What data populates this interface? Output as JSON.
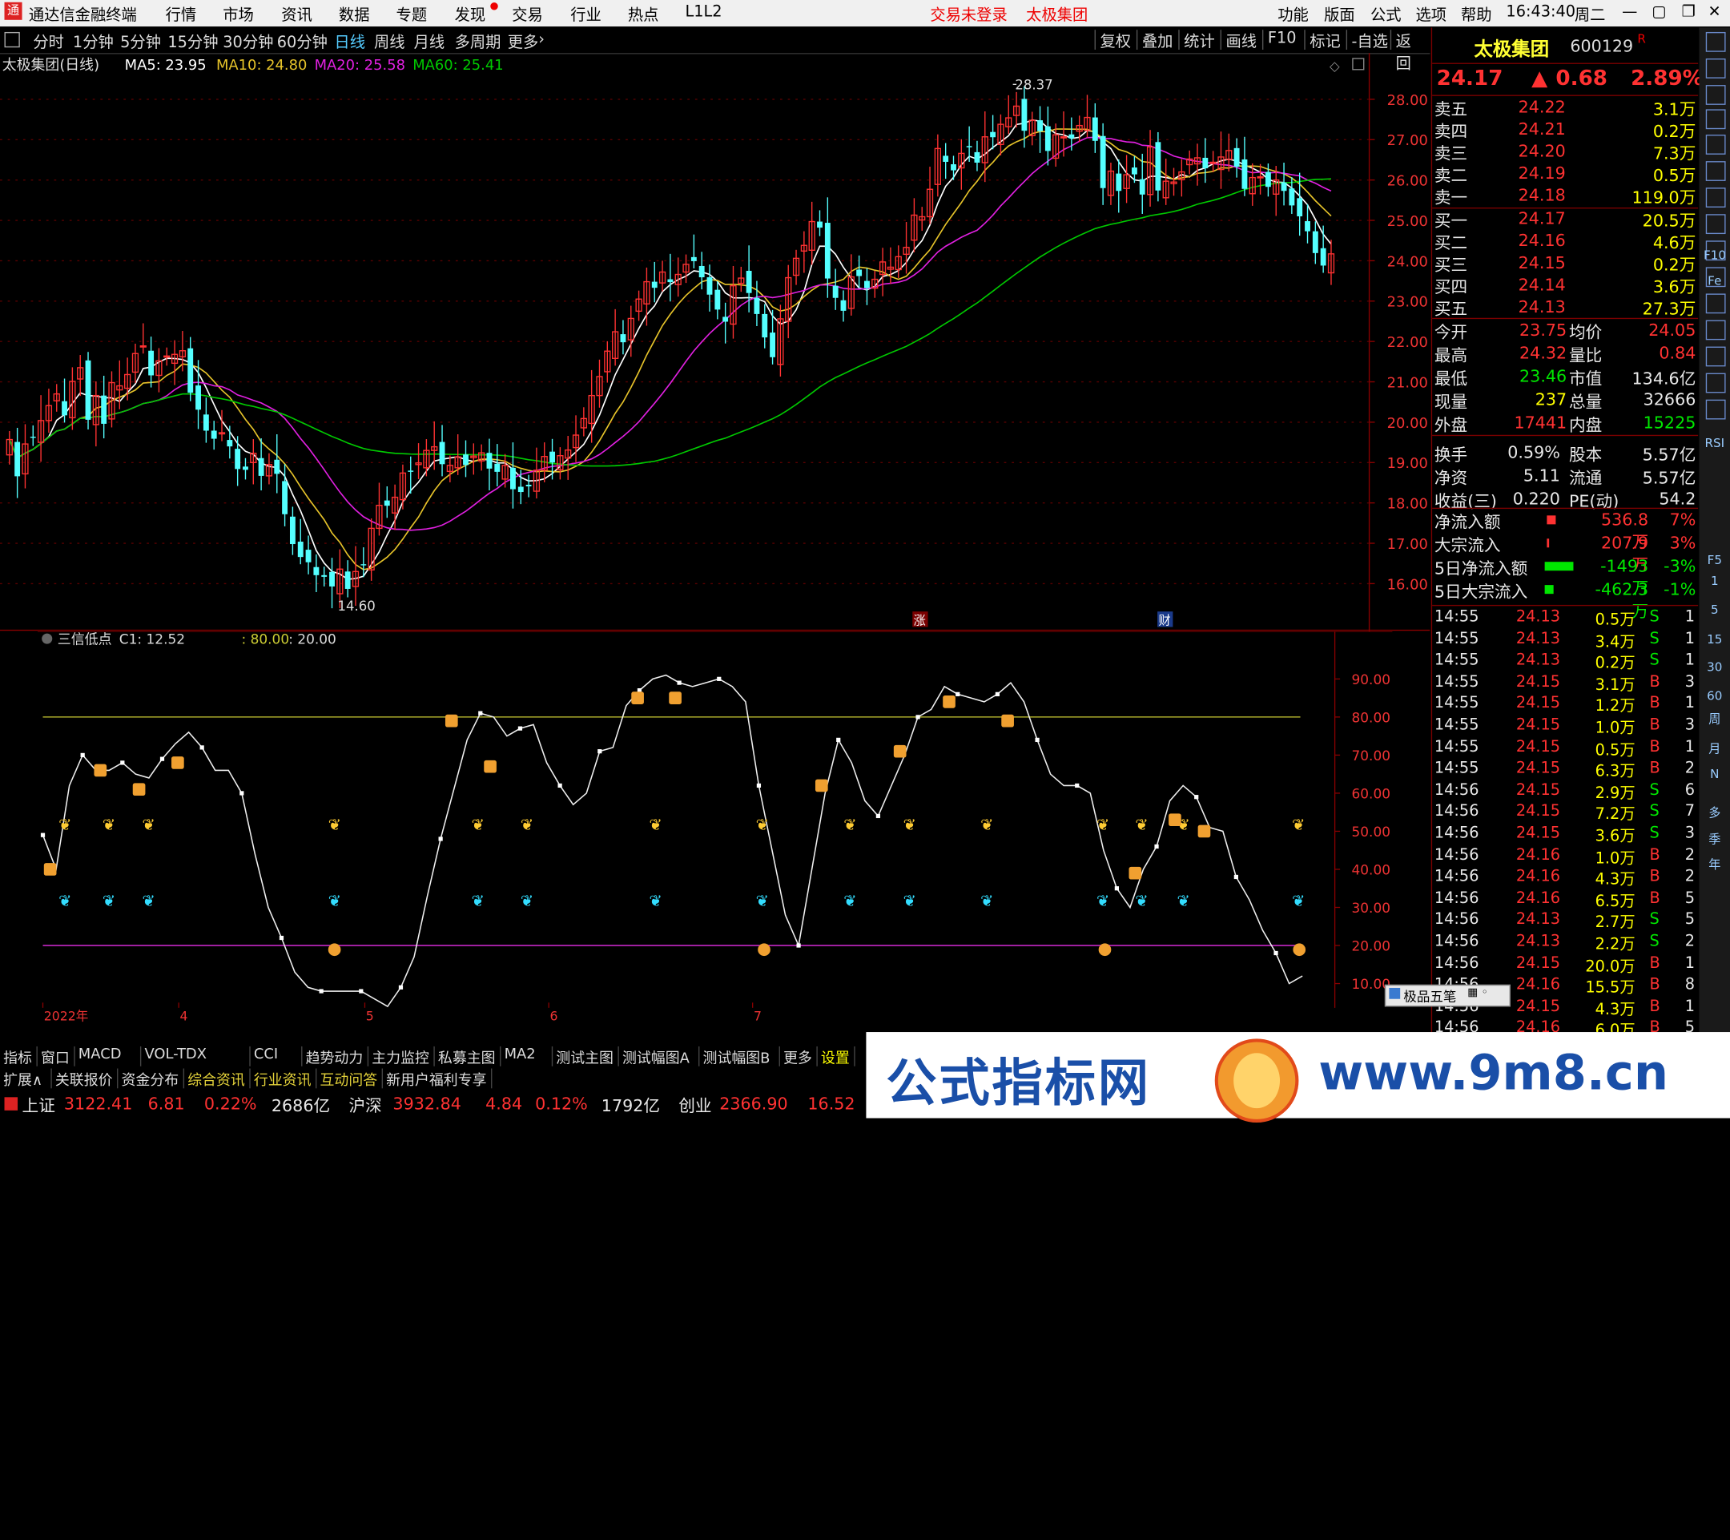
{
  "window": {
    "app_title": "通达信金融终端",
    "menu": [
      "行情",
      "市场",
      "资讯",
      "数据",
      "专题",
      "发现",
      "交易",
      "行业",
      "热点",
      "L1L2"
    ],
    "center": [
      "交易未登录",
      "太极集团"
    ],
    "right_menu": [
      "功能",
      "版面",
      "公式",
      "选项",
      "帮助"
    ],
    "clock": "16:43:40",
    "weekday": "周二"
  },
  "periods": [
    "分时",
    "1分钟",
    "5分钟",
    "15分钟",
    "30分钟",
    "60分钟",
    "日线",
    "周线",
    "月线",
    "多周期",
    "更多"
  ],
  "active_period": "日线",
  "toolbar": [
    "复权",
    "叠加",
    "统计",
    "画线",
    "F10",
    "标记",
    "-自选",
    "返回"
  ],
  "main_header": {
    "name": "太极集团(日线)",
    "ma5": "MA5: 23.95",
    "ma10": "MA10: 24.80",
    "ma20": "MA20: 25.58",
    "ma60": "MA60: 25.41"
  },
  "sub_header": {
    "name": "三信低点",
    "c1": "C1: 12.52",
    "l80": ": 80.00",
    "l20": ": 20.00"
  },
  "markers": {
    "high": "28.37",
    "low": "14.60",
    "zhang": "涨",
    "cai": "财"
  },
  "xaxis": [
    "2022年",
    "4",
    "5",
    "6",
    "7"
  ],
  "stock": {
    "name": "太极集团",
    "code": "600129",
    "r": "R",
    "price": "24.17",
    "change": "0.68",
    "pct": "2.89%"
  },
  "sell": [
    {
      "label": "卖五",
      "price": "24.22",
      "vol": "3.1万"
    },
    {
      "label": "卖四",
      "price": "24.21",
      "vol": "0.2万"
    },
    {
      "label": "卖三",
      "price": "24.20",
      "vol": "7.3万"
    },
    {
      "label": "卖二",
      "price": "24.19",
      "vol": "0.5万"
    },
    {
      "label": "卖一",
      "price": "24.18",
      "vol": "119.0万"
    }
  ],
  "buy": [
    {
      "label": "买一",
      "price": "24.17",
      "vol": "20.5万"
    },
    {
      "label": "买二",
      "price": "24.16",
      "vol": "4.6万"
    },
    {
      "label": "买三",
      "price": "24.15",
      "vol": "0.2万"
    },
    {
      "label": "买四",
      "price": "24.14",
      "vol": "3.6万"
    },
    {
      "label": "买五",
      "price": "24.13",
      "vol": "27.3万"
    }
  ],
  "stats": [
    [
      "今开",
      "23.75",
      "均价",
      "24.05"
    ],
    [
      "最高",
      "24.32",
      "量比",
      "0.84"
    ],
    [
      "最低",
      "23.46",
      "市值",
      "134.6亿"
    ],
    [
      "现量",
      "237",
      "总量",
      "32666"
    ],
    [
      "外盘",
      "17441",
      "内盘",
      "15225"
    ],
    [
      "换手",
      "0.59%",
      "股本",
      "5.57亿"
    ],
    [
      "净资",
      "5.11",
      "流通",
      "5.57亿"
    ],
    [
      "收益(三)",
      "0.220",
      "PE(动)",
      "54.2"
    ]
  ],
  "flows": [
    [
      "净流入额",
      "536.8万",
      "7%"
    ],
    [
      "大宗流入",
      "207.9万",
      "3%"
    ],
    [
      "5日净流入额",
      "-1493万",
      "-3%"
    ],
    [
      "5日大宗流入",
      "-462.3万",
      "-1%"
    ]
  ],
  "ticks": [
    [
      "14:55",
      "24.13",
      "0.5万",
      "S",
      "1"
    ],
    [
      "14:55",
      "24.13",
      "3.4万",
      "S",
      "1"
    ],
    [
      "14:55",
      "24.13",
      "0.2万",
      "S",
      "1"
    ],
    [
      "14:55",
      "24.15",
      "3.1万",
      "B",
      "3"
    ],
    [
      "14:55",
      "24.15",
      "1.2万",
      "B",
      "1"
    ],
    [
      "14:55",
      "24.15",
      "1.0万",
      "B",
      "3"
    ],
    [
      "14:55",
      "24.15",
      "0.5万",
      "B",
      "1"
    ],
    [
      "14:55",
      "24.15",
      "6.3万",
      "B",
      "2"
    ],
    [
      "14:56",
      "24.15",
      "2.9万",
      "S",
      "6"
    ],
    [
      "14:56",
      "24.15",
      "7.2万",
      "S",
      "7"
    ],
    [
      "14:56",
      "24.15",
      "3.6万",
      "S",
      "3"
    ],
    [
      "14:56",
      "24.16",
      "1.0万",
      "B",
      "2"
    ],
    [
      "14:56",
      "24.16",
      "4.3万",
      "B",
      "2"
    ],
    [
      "14:56",
      "24.16",
      "6.5万",
      "B",
      "5"
    ],
    [
      "14:56",
      "24.13",
      "2.7万",
      "S",
      "5"
    ],
    [
      "14:56",
      "24.13",
      "2.2万",
      "S",
      "2"
    ],
    [
      "14:56",
      "24.15",
      "20.0万",
      "B",
      "1"
    ],
    [
      "14:56",
      "24.16",
      "15.5万",
      "B",
      "8"
    ],
    [
      "14:56",
      "24.15",
      "4.3万",
      "B",
      "1"
    ],
    [
      "14:56",
      "24.16",
      "6.0万",
      "B",
      "5"
    ]
  ],
  "popup": "极品五笔",
  "tabs1": [
    "指标",
    "窗口",
    "MACD",
    "VOL-TDX",
    "CCI",
    "趋势动力",
    "主力监控",
    "私募主图",
    "MA2",
    "测试主图",
    "测试幅图A",
    "测试幅图B",
    "更多",
    "设置"
  ],
  "tabs2": [
    "扩展∧",
    "关联报价",
    "资金分布",
    "综合资讯",
    "行业资讯",
    "互动问答",
    "新用户福利专享"
  ],
  "status": {
    "sh": "上证",
    "sh_v": "3122.41",
    "sh_c": "6.81",
    "sh_p": "0.22%",
    "sh_a": "2686亿",
    "sz": "沪深",
    "sz_v": "3932.84",
    "sz_c": "4.84",
    "sz_p": "0.12%",
    "sz_a": "1792亿",
    "cy": "创业",
    "cy_v": "2366.90",
    "cy_c": "16.52"
  },
  "watermark": {
    "text": "公式指标网",
    "url": "www.9m8.cn"
  },
  "right_icons": [
    "RSI",
    "多",
    "季",
    "年",
    "周",
    "月",
    "N",
    "1",
    "5",
    "15",
    "30",
    "60",
    "F10",
    "Fe",
    "F5"
  ],
  "chart_data": [
    {
      "type": "candlestick",
      "title": "太极集团(日线)",
      "ylim": [
        15.2,
        28.6
      ],
      "yticks": [
        16,
        17,
        18,
        19,
        20,
        21,
        22,
        23,
        24,
        25,
        26,
        27,
        28
      ],
      "series": [
        {
          "name": "MA5",
          "color": "#ffffff"
        },
        {
          "name": "MA10",
          "color": "#e6c32a"
        },
        {
          "name": "MA20",
          "color": "#e020e0"
        },
        {
          "name": "MA60",
          "color": "#00c800"
        }
      ],
      "close": [
        19.57,
        18.66,
        19.46,
        19.62,
        20.04,
        20.41,
        20.7,
        20.17,
        21.01,
        21.35,
        20.06,
        20.66,
        19.96,
        20.98,
        20.9,
        21.18,
        21.7,
        21.89,
        21.16,
        21.52,
        21.64,
        21.68,
        21.77,
        20.73,
        20.31,
        19.79,
        19.59,
        19.74,
        19.4,
        18.84,
        18.82,
        19.23,
        18.67,
        18.95,
        18.72,
        17.72,
        16.98,
        16.66,
        16.53,
        16.21,
        16.17,
        15.93,
        16.36,
        15.87,
        16.3,
        16.46,
        17.37,
        17.94,
        17.93,
        18.14,
        18.74,
        18.77,
        18.99,
        19.3,
        19.39,
        18.96,
        18.93,
        19.14,
        18.94,
        19.16,
        19.24,
        18.85,
        18.77,
        18.93,
        18.34,
        18.27,
        18.41,
        18.81,
        19.15,
        19.0,
        19.17,
        19.31,
        19.68,
        20.09,
        20.66,
        21.13,
        21.76,
        22.24,
        21.98,
        22.57,
        23.05,
        23.48,
        23.33,
        23.72,
        23.47,
        23.66,
        23.91,
        23.99,
        23.59,
        23.16,
        22.79,
        22.49,
        23.38,
        23.57,
        23.2,
        22.68,
        22.1,
        21.61,
        22.56,
        23.58,
        24.06,
        24.38,
        24.97,
        24.82,
        23.56,
        23.08,
        22.76,
        23.6,
        23.62,
        23.32,
        23.54,
        23.97,
        23.84,
        24.1,
        24.33,
        25.13,
        25.09,
        25.77,
        26.78,
        26.45,
        26.24,
        26.66,
        26.81,
        26.43,
        27.07,
        27.06,
        27.38,
        27.54,
        27.83,
        27.22,
        27.48,
        27.21,
        26.72,
        27.12,
        27.07,
        27.03,
        27.35,
        27.55,
        26.97,
        25.8,
        26.22,
        25.73,
        26.13,
        26.14,
        25.64,
        26.82,
        25.74,
        25.97,
        25.95,
        26.2,
        26.52,
        26.55,
        26.29,
        26.44,
        26.57,
        26.73,
        26.33,
        25.78,
        26.06,
        26.08,
        25.83,
        26.0,
        25.73,
        25.37,
        25.1,
        24.73,
        24.19,
        23.88,
        24.17
      ],
      "high": 28.37,
      "low": 14.6
    },
    {
      "type": "line",
      "title": "三信低点",
      "ylim": [
        5,
        97
      ],
      "yticks": [
        10,
        20,
        30,
        40,
        50,
        60,
        70,
        80,
        90
      ],
      "hlines": [
        {
          "value": 80,
          "color": "#cccc33"
        },
        {
          "value": 20,
          "color": "#ff33ff"
        }
      ],
      "c1": [
        49,
        40,
        62,
        70,
        66,
        66,
        68,
        65,
        64,
        69,
        73,
        76,
        72,
        66,
        66,
        60,
        44,
        30,
        22,
        13,
        9,
        8,
        8,
        8,
        8,
        6,
        4,
        9,
        17,
        33,
        48,
        61,
        74,
        81,
        80,
        75,
        77,
        78,
        68,
        62,
        57,
        60,
        71,
        72,
        83,
        87,
        90,
        91,
        89,
        88,
        89,
        90,
        88,
        84,
        62,
        45,
        28,
        20,
        40,
        60,
        74,
        68,
        58,
        54,
        62,
        70,
        80,
        82,
        88,
        86,
        85,
        84,
        86,
        89,
        84,
        74,
        65,
        62,
        62,
        60,
        45,
        35,
        30,
        40,
        46,
        58,
        62,
        59,
        51,
        50,
        38,
        32,
        24,
        18,
        10,
        12
      ]
    }
  ]
}
